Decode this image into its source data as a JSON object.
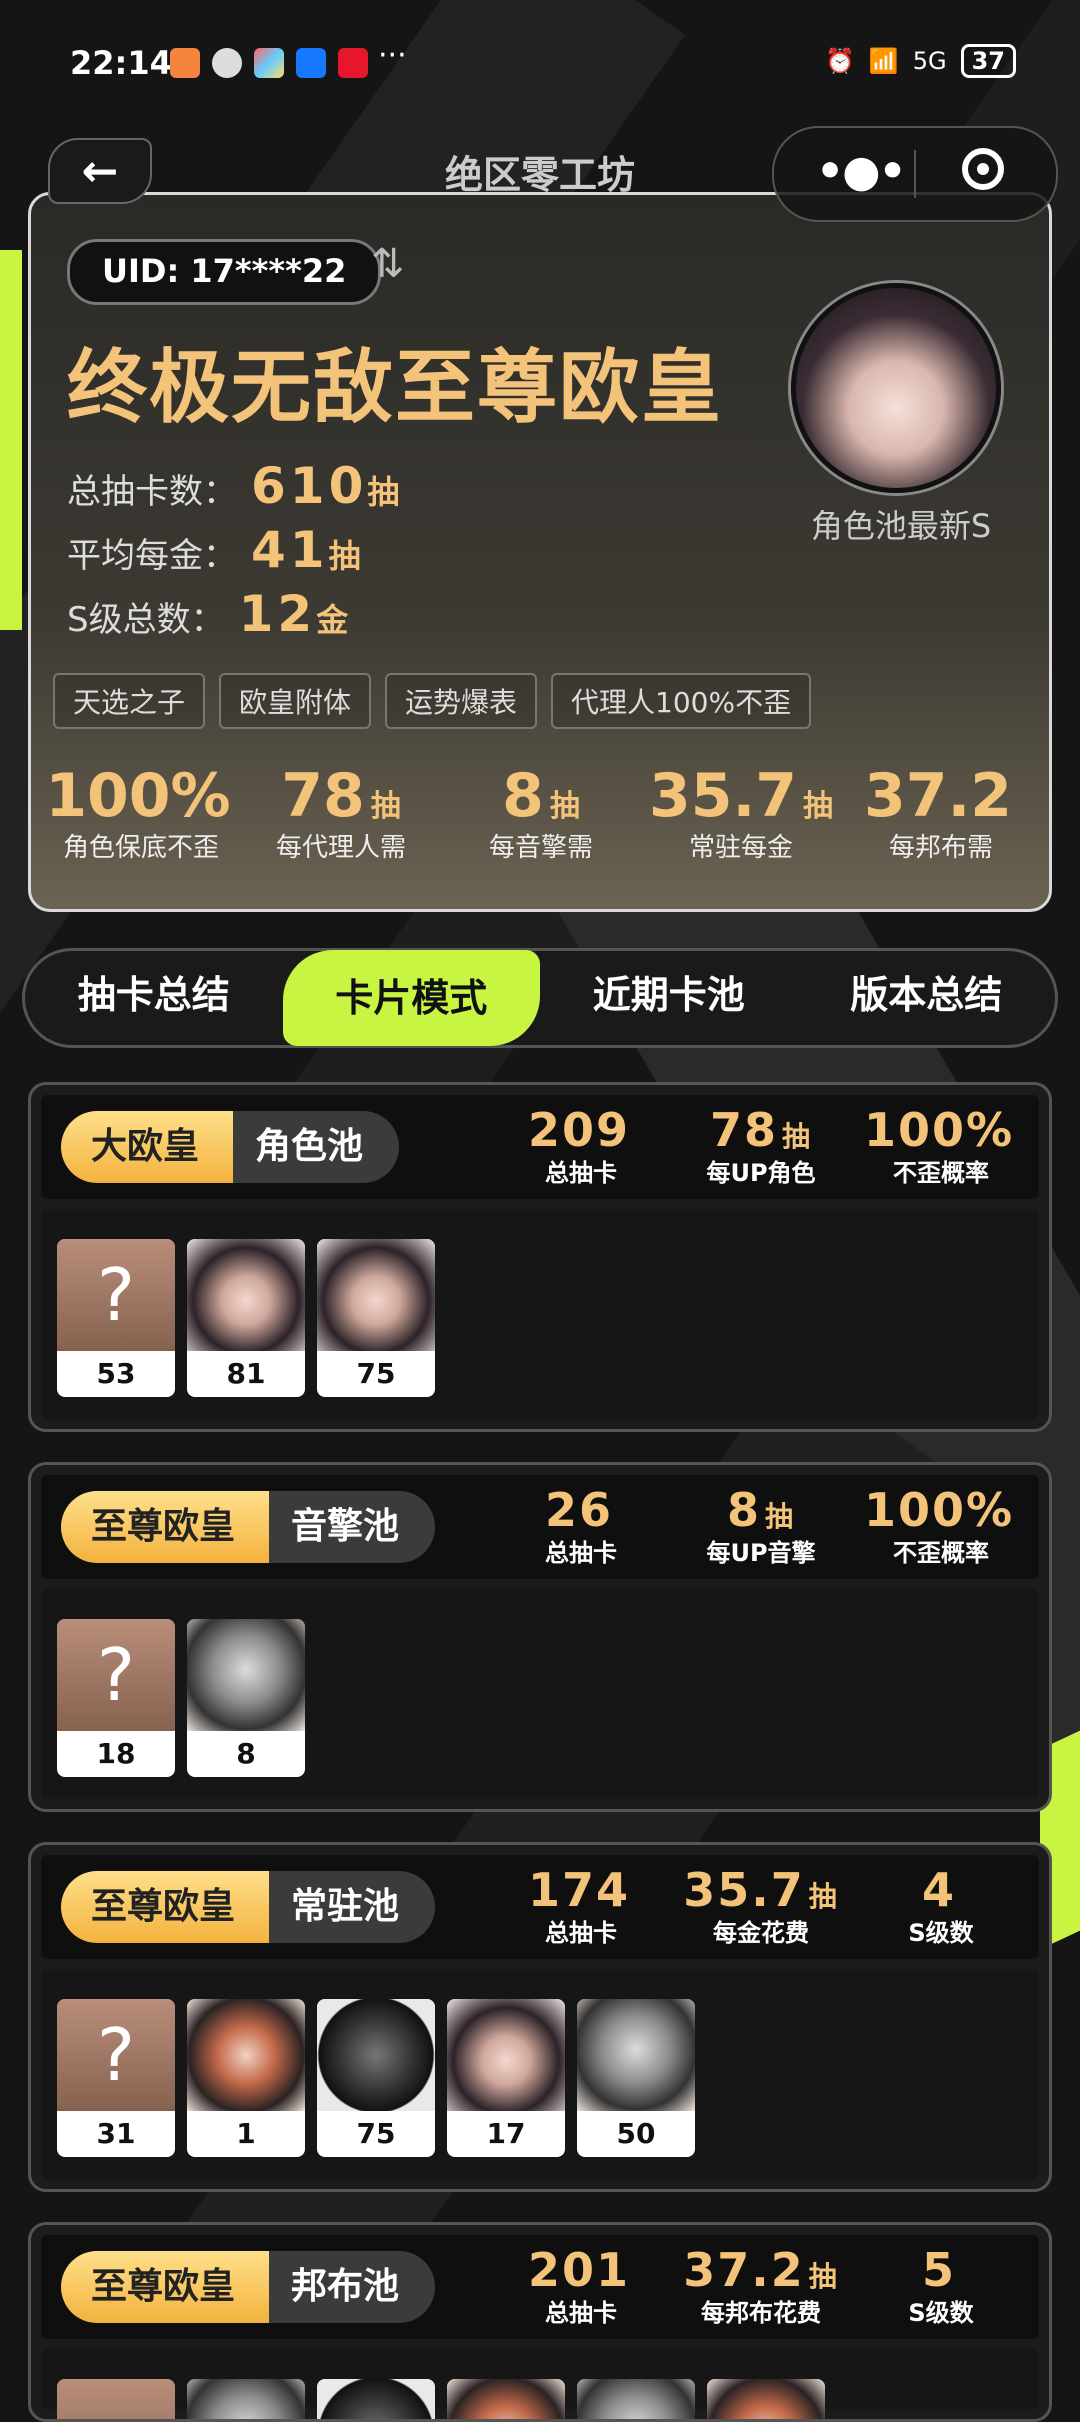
{
  "status": {
    "time": "22:14",
    "more": "···",
    "network": "5G",
    "battery": "37"
  },
  "nav": {
    "back": "←",
    "title": "绝区零工坊"
  },
  "profile": {
    "uid": "UID: 17****22",
    "swap_icon": "⇅",
    "title": "终极无敌至尊欧皇",
    "stats": [
      {
        "label": "总抽卡数：",
        "value": "610",
        "unit": "抽"
      },
      {
        "label": "平均每金：",
        "value": "41",
        "unit": "抽"
      },
      {
        "label": "S级总数：",
        "value": "12",
        "unit": "金"
      }
    ],
    "avatar_caption": "角色池最新S",
    "tags": [
      "天选之子",
      "欧皇附体",
      "运势爆表",
      "代理人100%不歪"
    ],
    "summary": [
      {
        "value": "100%",
        "unit": "",
        "label": "角色保底不歪"
      },
      {
        "value": "78",
        "unit": "抽",
        "label": "每代理人需"
      },
      {
        "value": "8",
        "unit": "抽",
        "label": "每音擎需"
      },
      {
        "value": "35.7",
        "unit": "抽",
        "label": "常驻每金"
      },
      {
        "value": "37.2",
        "unit": "",
        "label": "每邦布需"
      }
    ]
  },
  "tabs": [
    "抽卡总结",
    "卡片模式",
    "近期卡池",
    "版本总结"
  ],
  "pools": [
    {
      "rank": "大欧皇",
      "name": "角色池",
      "stats": [
        {
          "value": "209",
          "unit": "",
          "label": "总抽卡"
        },
        {
          "value": "78",
          "unit": "抽",
          "label": "每UP角色"
        },
        {
          "value": "100%",
          "unit": "",
          "label": "不歪概率"
        }
      ],
      "cards": [
        "53",
        "81",
        "75"
      ]
    },
    {
      "rank": "至尊欧皇",
      "name": "音擎池",
      "stats": [
        {
          "value": "26",
          "unit": "",
          "label": "总抽卡"
        },
        {
          "value": "8",
          "unit": "抽",
          "label": "每UP音擎"
        },
        {
          "value": "100%",
          "unit": "",
          "label": "不歪概率"
        }
      ],
      "cards": [
        "18",
        "8"
      ]
    },
    {
      "rank": "至尊欧皇",
      "name": "常驻池",
      "stats": [
        {
          "value": "174",
          "unit": "",
          "label": "总抽卡"
        },
        {
          "value": "35.7",
          "unit": "抽",
          "label": "每金花费"
        },
        {
          "value": "4",
          "unit": "",
          "label": "S级数"
        }
      ],
      "cards": [
        "31",
        "1",
        "75",
        "17",
        "50"
      ]
    },
    {
      "rank": "至尊欧皇",
      "name": "邦布池",
      "stats": [
        {
          "value": "201",
          "unit": "",
          "label": "总抽卡"
        },
        {
          "value": "37.2",
          "unit": "抽",
          "label": "每邦布花费"
        },
        {
          "value": "5",
          "unit": "",
          "label": "S级数"
        }
      ],
      "cards": []
    }
  ],
  "unknown_mark": "?"
}
